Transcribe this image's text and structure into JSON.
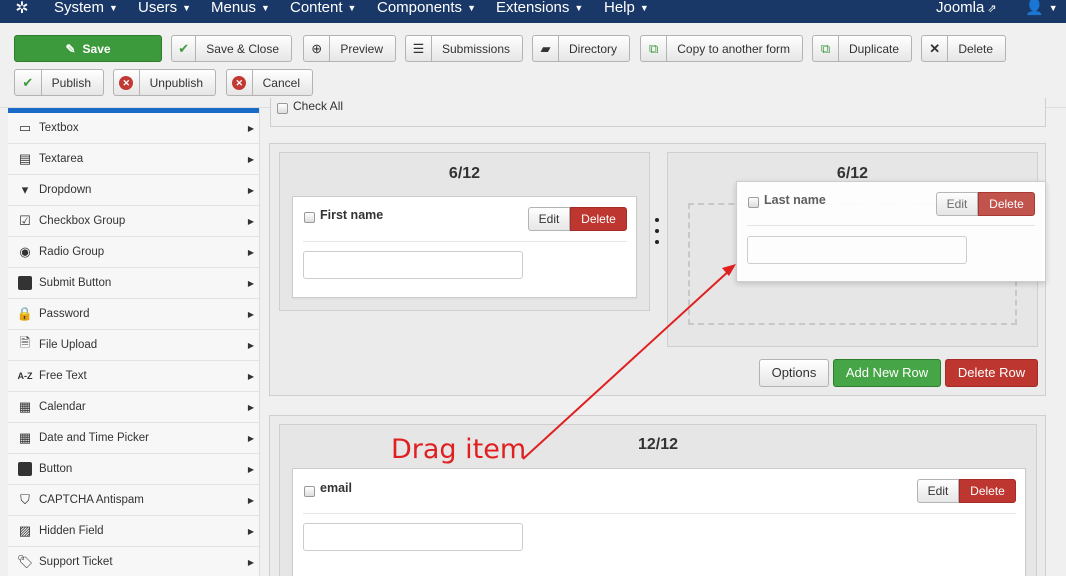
{
  "topbar": {
    "menus": [
      "System",
      "Users",
      "Menus",
      "Content",
      "Components",
      "Extensions",
      "Help"
    ],
    "site_link": "Joomla",
    "user_icon": "user-icon"
  },
  "toolbar": {
    "save": "Save",
    "save_close": "Save & Close",
    "preview": "Preview",
    "submissions": "Submissions",
    "directory": "Directory",
    "copy": "Copy to another form",
    "duplicate": "Duplicate",
    "delete": "Delete",
    "publish": "Publish",
    "unpublish": "Unpublish",
    "cancel": "Cancel"
  },
  "sidebar": {
    "items": [
      {
        "label": "Textbox",
        "icon": "textbox-icon"
      },
      {
        "label": "Textarea",
        "icon": "textarea-icon"
      },
      {
        "label": "Dropdown",
        "icon": "dropdown-icon"
      },
      {
        "label": "Checkbox Group",
        "icon": "checkbox-icon"
      },
      {
        "label": "Radio Group",
        "icon": "radio-icon"
      },
      {
        "label": "Submit Button",
        "icon": "square-icon"
      },
      {
        "label": "Password",
        "icon": "lock-icon"
      },
      {
        "label": "File Upload",
        "icon": "file-icon"
      },
      {
        "label": "Free Text",
        "icon": "az-icon"
      },
      {
        "label": "Calendar",
        "icon": "calendar-icon"
      },
      {
        "label": "Date and Time Picker",
        "icon": "calendar-grid-icon"
      },
      {
        "label": "Button",
        "icon": "square-icon"
      },
      {
        "label": "CAPTCHA Antispam",
        "icon": "shield-icon"
      },
      {
        "label": "Hidden Field",
        "icon": "hidden-icon"
      },
      {
        "label": "Support Ticket",
        "icon": "ticket-icon"
      }
    ]
  },
  "main": {
    "check_all": "Check All",
    "row1": {
      "col1_header": "6/12",
      "col2_header": "6/12",
      "first_name_label": "First name",
      "last_name_label": "Last name",
      "edit": "Edit",
      "delete": "Delete",
      "options": "Options",
      "add_row": "Add New Row",
      "delete_row": "Delete Row"
    },
    "row2": {
      "col_header": "12/12",
      "email_label": "email",
      "edit": "Edit",
      "delete": "Delete"
    },
    "annotation": "Drag item"
  },
  "colors": {
    "topbar": "#1a3867",
    "save_green": "#3c9a3c",
    "delete_red": "#bd362f",
    "annotation_red": "#e02020"
  }
}
